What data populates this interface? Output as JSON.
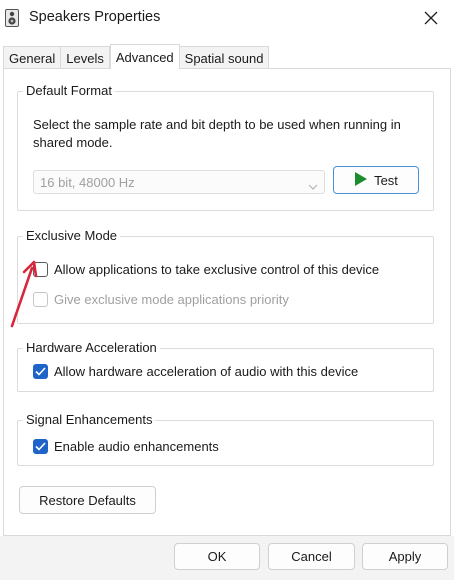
{
  "window": {
    "title": "Speakers Properties",
    "icon": "speaker-icon"
  },
  "tabs": [
    {
      "label": "General",
      "active": false
    },
    {
      "label": "Levels",
      "active": false
    },
    {
      "label": "Advanced",
      "active": true
    },
    {
      "label": "Spatial sound",
      "active": false
    }
  ],
  "default_format": {
    "legend": "Default Format",
    "description": "Select the sample rate and bit depth to be used when running in shared mode.",
    "selected_format": "16 bit, 48000 Hz",
    "test_label": "Test"
  },
  "exclusive_mode": {
    "legend": "Exclusive Mode",
    "allow_exclusive": {
      "label": "Allow applications to take exclusive control of this device",
      "checked": false
    },
    "priority": {
      "label": "Give exclusive mode applications priority",
      "checked": false,
      "disabled": true
    }
  },
  "hardware_acceleration": {
    "legend": "Hardware Acceleration",
    "allow_hw": {
      "label": "Allow hardware acceleration of audio with this device",
      "checked": true
    }
  },
  "signal_enhancements": {
    "legend": "Signal Enhancements",
    "enable": {
      "label": "Enable audio enhancements",
      "checked": true
    }
  },
  "restore_label": "Restore Defaults",
  "footer": {
    "ok_label": "OK",
    "cancel_label": "Cancel",
    "apply_label": "Apply"
  },
  "colors": {
    "accent": "#1f64c9",
    "test_play": "#1e8c2d",
    "annotation": "#d8263a"
  }
}
